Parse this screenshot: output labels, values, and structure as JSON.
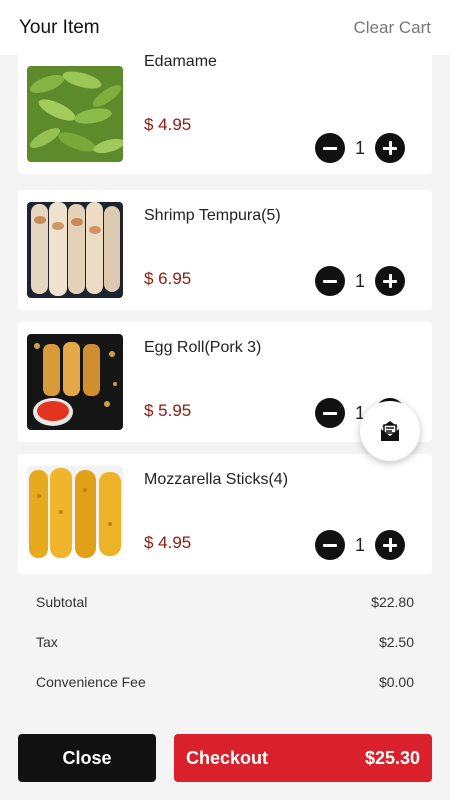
{
  "header": {
    "title": "Your Item",
    "clear_label": "Clear Cart"
  },
  "items": [
    {
      "name": "Edamame",
      "price": "$ 4.95",
      "qty": "1",
      "image": "edamame-photo"
    },
    {
      "name": "Shrimp Tempura(5)",
      "price": "$ 6.95",
      "qty": "1",
      "image": "shrimp-tempura-photo"
    },
    {
      "name": "Egg Roll(Pork 3)",
      "price": "$ 5.95",
      "qty": "1",
      "image": "egg-roll-photo"
    },
    {
      "name": "Mozzarella Sticks(4)",
      "price": "$ 4.95",
      "qty": "1",
      "image": "mozzarella-sticks-photo"
    }
  ],
  "summary": {
    "subtotal_label": "Subtotal",
    "subtotal": "$22.80",
    "tax_label": "Tax",
    "tax": "$2.50",
    "fee_label": "Convenience Fee",
    "fee": "$0.00"
  },
  "footer": {
    "close_label": "Close",
    "checkout_label": "Checkout",
    "total": "$25.30"
  },
  "colors": {
    "price": "#8a1b10",
    "checkout": "#d9202b",
    "close": "#111111",
    "background": "#f4f4f4"
  },
  "fab_icon": "message-icon"
}
